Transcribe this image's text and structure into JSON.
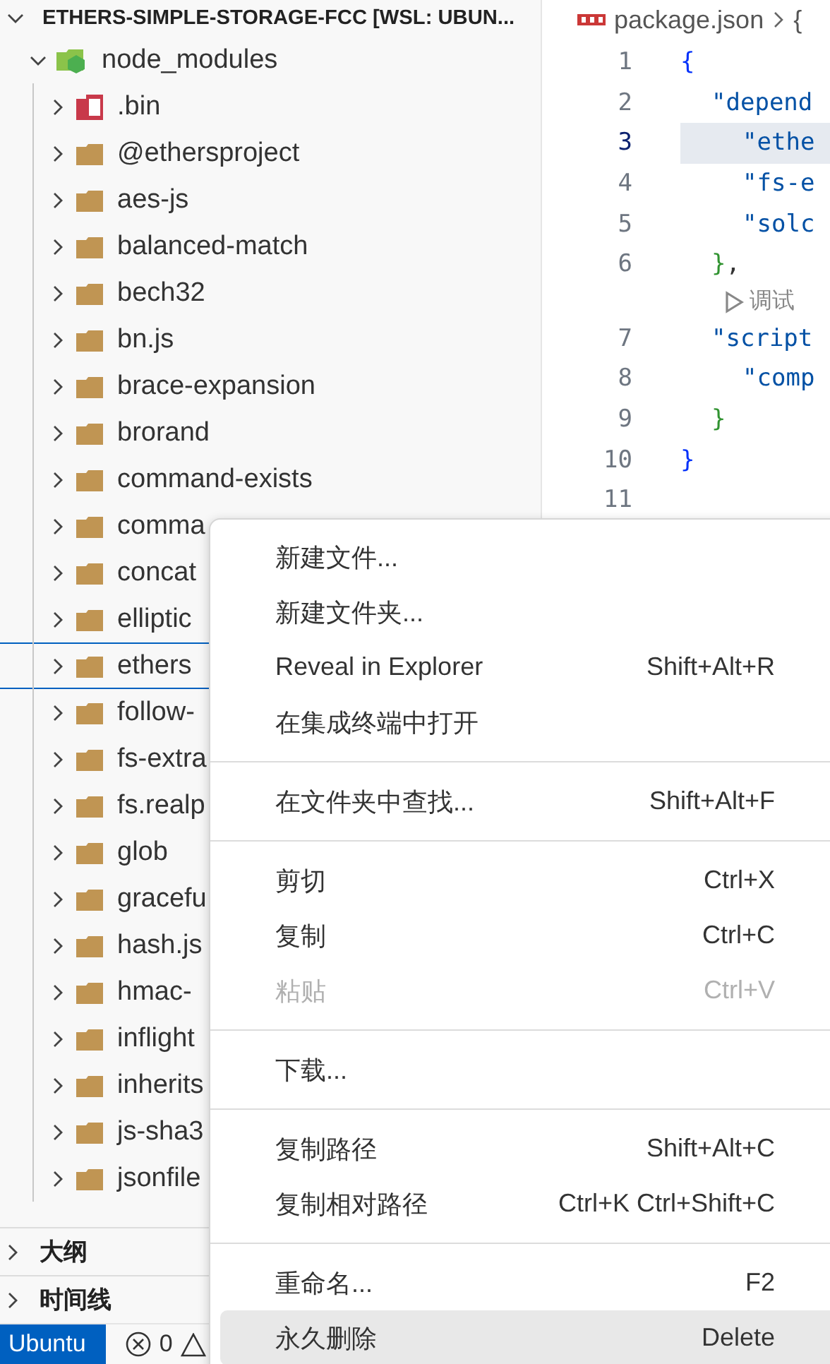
{
  "explorer": {
    "title": "ETHERS-SIMPLE-STORAGE-FCC [WSL: UBUN...",
    "expanded": true,
    "root": {
      "label": "node_modules",
      "expanded": true,
      "children": [
        {
          "label": ".bin",
          "kind": "binary",
          "expanded": false,
          "focused": false
        },
        {
          "label": "@ethersproject",
          "kind": "folder",
          "expanded": false,
          "focused": false
        },
        {
          "label": "aes-js",
          "kind": "folder",
          "expanded": false,
          "focused": false
        },
        {
          "label": "balanced-match",
          "kind": "folder",
          "expanded": false,
          "focused": false
        },
        {
          "label": "bech32",
          "kind": "folder",
          "expanded": false,
          "focused": false
        },
        {
          "label": "bn.js",
          "kind": "folder",
          "expanded": false,
          "focused": false
        },
        {
          "label": "brace-expansion",
          "kind": "folder",
          "expanded": false,
          "focused": false
        },
        {
          "label": "brorand",
          "kind": "folder",
          "expanded": false,
          "focused": false
        },
        {
          "label": "command-exists",
          "kind": "folder",
          "expanded": false,
          "focused": false
        },
        {
          "label": "comma",
          "kind": "folder",
          "expanded": false,
          "focused": false
        },
        {
          "label": "concat",
          "kind": "folder",
          "expanded": false,
          "focused": false
        },
        {
          "label": "elliptic",
          "kind": "folder",
          "expanded": false,
          "focused": false
        },
        {
          "label": "ethers",
          "kind": "folder",
          "expanded": false,
          "focused": true
        },
        {
          "label": "follow-",
          "kind": "folder",
          "expanded": false,
          "focused": false
        },
        {
          "label": "fs-extra",
          "kind": "folder",
          "expanded": false,
          "focused": false
        },
        {
          "label": "fs.realp",
          "kind": "folder",
          "expanded": false,
          "focused": false
        },
        {
          "label": "glob",
          "kind": "folder",
          "expanded": false,
          "focused": false
        },
        {
          "label": "gracefu",
          "kind": "folder",
          "expanded": false,
          "focused": false
        },
        {
          "label": "hash.js",
          "kind": "folder",
          "expanded": false,
          "focused": false
        },
        {
          "label": "hmac-",
          "kind": "folder",
          "expanded": false,
          "focused": false
        },
        {
          "label": "inflight",
          "kind": "folder",
          "expanded": false,
          "focused": false
        },
        {
          "label": "inherits",
          "kind": "folder",
          "expanded": false,
          "focused": false
        },
        {
          "label": "js-sha3",
          "kind": "folder",
          "expanded": false,
          "focused": false
        },
        {
          "label": "jsonfile",
          "kind": "folder",
          "expanded": false,
          "focused": false
        }
      ]
    }
  },
  "panels": [
    {
      "label": "大纲",
      "expanded": false
    },
    {
      "label": "时间线",
      "expanded": false
    }
  ],
  "editor": {
    "breadcrumb": [
      "package.json",
      "{"
    ],
    "lines": [
      {
        "kind": "code",
        "number": "1",
        "current": false,
        "tokens": [
          {
            "text": "{",
            "kind": "brace"
          }
        ],
        "children": [
          {
            "kind": "code",
            "number": "2",
            "current": false,
            "tokens": [
              {
                "text": "\"depend",
                "kind": "key"
              }
            ],
            "children": [
              {
                "kind": "code",
                "number": "3",
                "current": true,
                "tokens": [
                  {
                    "text": "\"ethe",
                    "kind": "key"
                  }
                ]
              },
              {
                "kind": "code",
                "number": "4",
                "current": false,
                "tokens": [
                  {
                    "text": "\"fs-e",
                    "kind": "key"
                  }
                ]
              },
              {
                "kind": "code",
                "number": "5",
                "current": false,
                "tokens": [
                  {
                    "text": "\"solc",
                    "kind": "key"
                  }
                ]
              }
            ]
          },
          {
            "kind": "code",
            "number": "6",
            "current": false,
            "tokens": [
              {
                "text": "}",
                "kind": "brace2"
              },
              {
                "text": ",",
                "kind": "punct"
              }
            ]
          },
          {
            "kind": "codelens",
            "label": "调试"
          },
          {
            "kind": "code",
            "number": "7",
            "current": false,
            "tokens": [
              {
                "text": "\"script",
                "kind": "key"
              }
            ],
            "children": [
              {
                "kind": "code",
                "number": "8",
                "current": false,
                "tokens": [
                  {
                    "text": "\"comp",
                    "kind": "key"
                  }
                ]
              }
            ]
          },
          {
            "kind": "code",
            "number": "9",
            "current": false,
            "tokens": [
              {
                "text": "}",
                "kind": "brace2"
              }
            ]
          }
        ]
      },
      {
        "kind": "code",
        "number": "10",
        "current": false,
        "tokens": [
          {
            "text": "}",
            "kind": "brace"
          }
        ]
      },
      {
        "kind": "code",
        "number": "11",
        "current": false
      }
    ]
  },
  "context_menu": [
    {
      "kind": "item",
      "label": "新建文件...",
      "disabled": false,
      "hovered": false
    },
    {
      "kind": "item",
      "label": "新建文件夹...",
      "disabled": false,
      "hovered": false
    },
    {
      "kind": "item",
      "label": "Reveal in Explorer",
      "shortcut": "Shift+Alt+R",
      "disabled": false,
      "hovered": false
    },
    {
      "kind": "item",
      "label": "在集成终端中打开",
      "disabled": false,
      "hovered": false
    },
    {
      "kind": "separator"
    },
    {
      "kind": "item",
      "label": "在文件夹中查找...",
      "shortcut": "Shift+Alt+F",
      "disabled": false,
      "hovered": false
    },
    {
      "kind": "separator"
    },
    {
      "kind": "item",
      "label": "剪切",
      "shortcut": "Ctrl+X",
      "disabled": false,
      "hovered": false
    },
    {
      "kind": "item",
      "label": "复制",
      "shortcut": "Ctrl+C",
      "disabled": false,
      "hovered": false
    },
    {
      "kind": "item",
      "label": "粘贴",
      "shortcut": "Ctrl+V",
      "disabled": true,
      "hovered": false
    },
    {
      "kind": "separator"
    },
    {
      "kind": "item",
      "label": "下载...",
      "disabled": false,
      "hovered": false
    },
    {
      "kind": "separator"
    },
    {
      "kind": "item",
      "label": "复制路径",
      "shortcut": "Shift+Alt+C",
      "disabled": false,
      "hovered": false
    },
    {
      "kind": "item",
      "label": "复制相对路径",
      "shortcut": "Ctrl+K Ctrl+Shift+C",
      "disabled": false,
      "hovered": false
    },
    {
      "kind": "separator"
    },
    {
      "kind": "item",
      "label": "重命名...",
      "shortcut": "F2",
      "disabled": false,
      "hovered": false
    },
    {
      "kind": "item",
      "label": "永久删除",
      "shortcut": "Delete",
      "disabled": false,
      "hovered": true
    }
  ],
  "status_bar": {
    "remote": "Ubuntu",
    "errors": "0"
  }
}
